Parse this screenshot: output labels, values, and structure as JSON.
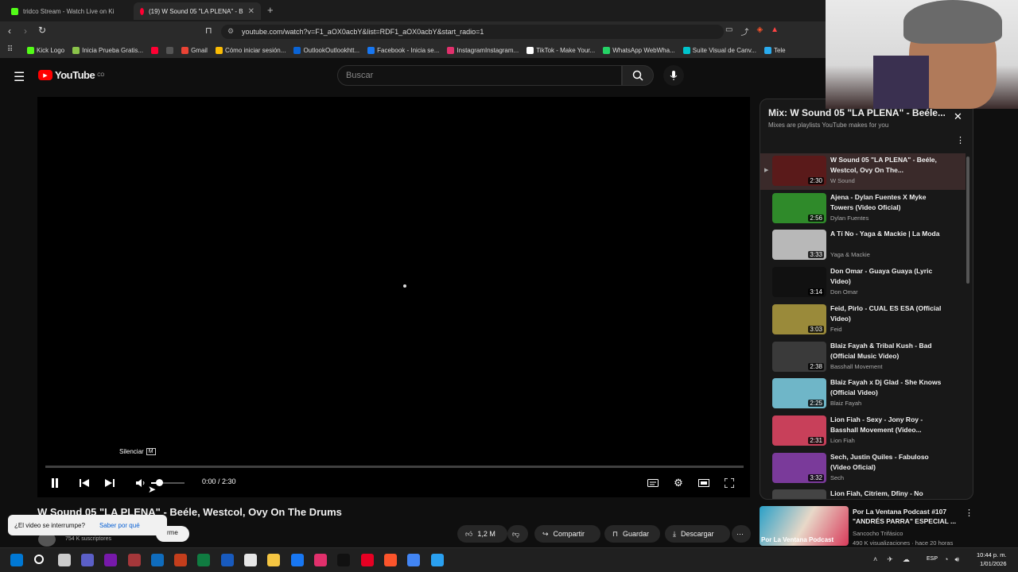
{
  "browser": {
    "tabs": [
      {
        "label": "tridco Stream - Watch Live on Ki",
        "icon": "kick-icon",
        "color": "#53fc18"
      },
      {
        "label": "(19) W Sound 05 \"LA PLENA\" - B",
        "icon": "youtube-icon",
        "color": "#ff0033"
      }
    ],
    "url": "youtube.com/watch?v=F1_aOX0acbY&list=RDF1_aOX0acbY&start_radio=1",
    "bookmarks": [
      {
        "label": "Kick Logo",
        "color": "#53fc18"
      },
      {
        "label": "Inicia Prueba Gratis...",
        "color": "#8bc34a"
      },
      {
        "label": "",
        "color": "#ff0033"
      },
      {
        "label": "",
        "color": "#555555"
      },
      {
        "label": "Gmail",
        "color": "#ea4335"
      },
      {
        "label": "Cómo iniciar sesión...",
        "color": "#fbbc04"
      },
      {
        "label": "OutlookOutlookhtt...",
        "color": "#0a64d6"
      },
      {
        "label": "Facebook - Inicia se...",
        "color": "#1877f2"
      },
      {
        "label": "InstagramInstagram...",
        "color": "#e1306c"
      },
      {
        "label": "TikTok - Make Your...",
        "color": "#ffffff"
      },
      {
        "label": "WhatsApp WebWha...",
        "color": "#25d366"
      },
      {
        "label": "Suite Visual de Canv...",
        "color": "#00c4cc"
      },
      {
        "label": "Tele",
        "color": "#2aabee"
      }
    ]
  },
  "youtube": {
    "logo": "YouTube",
    "country": "CO",
    "search_placeholder": "Buscar"
  },
  "player": {
    "time": "0:00 / 2:30",
    "tooltip": "Silenciar",
    "tooltip_key": "M",
    "progress_fraction": 0.0,
    "volume_fraction": 0.6
  },
  "video": {
    "title": "W Sound 05 \"LA PLENA\" - Beéle, Westcol, Ovy On The Drums",
    "subscribers": "754 K suscriptores",
    "interrupt_text": "¿El video se interrumpe?",
    "interrupt_link": "Saber por qué",
    "partial_label": "rme",
    "likes": "1,2 M",
    "share": "Compartir",
    "save": "Guardar",
    "download": "Descargar"
  },
  "playlist": {
    "title": "Mix: W Sound 05 \"LA PLENA\" - Beéle...",
    "subtitle": "Mixes are playlists YouTube makes for you",
    "items": [
      {
        "title": "W Sound 05 \"LA PLENA\" - Beéle, Westcol, Ovy On The...",
        "channel": "W Sound",
        "duration": "2:30",
        "thumb": "#5a1a1a"
      },
      {
        "title": "Ajena - Dylan Fuentes X Myke Towers (Video Oficial)",
        "channel": "Dylan Fuentes",
        "duration": "2:56",
        "thumb": "#2f8a2a"
      },
      {
        "title": "A Tí No - Yaga & Mackie | La Moda",
        "channel": "Yaga & Mackie",
        "duration": "3:33",
        "thumb": "#b8b8b8"
      },
      {
        "title": "Don Omar - Guaya Guaya (Lyric Video)",
        "channel": "Don Omar",
        "duration": "3:14",
        "thumb": "#111111"
      },
      {
        "title": "Feid, Pirlo - CUAL ES ESA (Official Video)",
        "channel": "Feid",
        "duration": "3:03",
        "thumb": "#9a8a3a"
      },
      {
        "title": "Blaiz Fayah & Tribal Kush - Bad (Official Music Video)",
        "channel": "Basshall Movement",
        "duration": "2:38",
        "thumb": "#3a3a3a"
      },
      {
        "title": "Blaiz Fayah x Dj Glad - She Knows (Official Video)",
        "channel": "Blaiz Fayah",
        "duration": "2:25",
        "thumb": "#6fb6c8"
      },
      {
        "title": "Lion Fiah - Sexy - Jony Roy - Basshall Movement (Video...",
        "channel": "Lion Fiah",
        "duration": "2:31",
        "thumb": "#c8405a"
      },
      {
        "title": "Sech, Justin Quiles - Fabuloso (Video Oficial)",
        "channel": "Sech",
        "duration": "3:32",
        "thumb": "#7a3a9a"
      },
      {
        "title": "Lion Fiah, Citriem, Dfiny - No",
        "channel": "",
        "duration": "",
        "thumb": "#444444"
      }
    ]
  },
  "recommended": {
    "title": "Por La Ventana Podcast #107 \"ANDRÉS PARRA\" ESPECIAL ...",
    "channel": "Sancocho Trifásico",
    "meta": "490 K visualizaciones · hace 20 horas",
    "thumb_text": "Por La Ventana Podcast"
  },
  "taskbar": {
    "lang": "ESP",
    "time": "10:44 p. m.",
    "date": "1/01/2026",
    "apps": [
      {
        "name": "start-icon",
        "color": "#0078d4"
      },
      {
        "name": "search-icon",
        "color": "#ffffff"
      },
      {
        "name": "taskview-icon",
        "color": "#cccccc"
      },
      {
        "name": "teams-icon",
        "color": "#5b5fc7"
      },
      {
        "name": "onenote-icon",
        "color": "#7719aa"
      },
      {
        "name": "access-icon",
        "color": "#a4373a"
      },
      {
        "name": "outlook-icon",
        "color": "#0f6cbd"
      },
      {
        "name": "powerpoint-icon",
        "color": "#c43e1c"
      },
      {
        "name": "excel-icon",
        "color": "#107c41"
      },
      {
        "name": "word-icon",
        "color": "#185abd"
      },
      {
        "name": "store-icon",
        "color": "#e6e6e6"
      },
      {
        "name": "explorer-icon",
        "color": "#f4c542"
      },
      {
        "name": "facebook-icon",
        "color": "#1877f2"
      },
      {
        "name": "instagram-icon",
        "color": "#e1306c"
      },
      {
        "name": "tiktok-icon",
        "color": "#111111"
      },
      {
        "name": "pinterest-icon",
        "color": "#e60023"
      },
      {
        "name": "brave-icon",
        "color": "#fb542b"
      },
      {
        "name": "chrome-icon",
        "color": "#4285f4"
      },
      {
        "name": "app-icon",
        "color": "#2aa0f0"
      }
    ]
  }
}
